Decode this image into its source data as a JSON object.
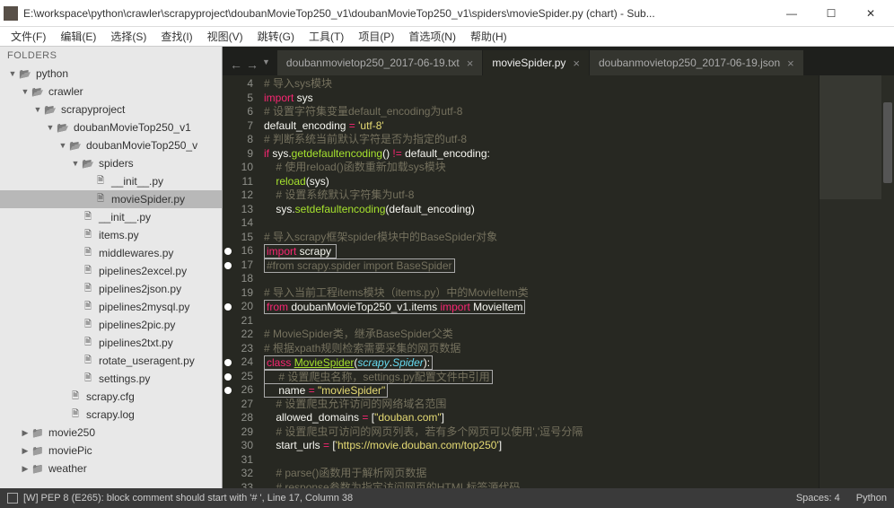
{
  "window": {
    "title": "E:\\workspace\\python\\crawler\\scrapyproject\\doubanMovieTop250_v1\\doubanMovieTop250_v1\\spiders\\movieSpider.py (chart) - Sub..."
  },
  "menu": [
    "文件(F)",
    "编辑(E)",
    "选择(S)",
    "查找(I)",
    "视图(V)",
    "跳转(G)",
    "工具(T)",
    "项目(P)",
    "首选项(N)",
    "帮助(H)"
  ],
  "sidebar": {
    "header": "FOLDERS",
    "tree": [
      {
        "depth": 0,
        "kind": "folder-open",
        "exp": "▼",
        "label": "python"
      },
      {
        "depth": 1,
        "kind": "folder-open",
        "exp": "▼",
        "label": "crawler"
      },
      {
        "depth": 2,
        "kind": "folder-open",
        "exp": "▼",
        "label": "scrapyproject"
      },
      {
        "depth": 3,
        "kind": "folder-open",
        "exp": "▼",
        "label": "doubanMovieTop250_v1"
      },
      {
        "depth": 4,
        "kind": "folder-open",
        "exp": "▼",
        "label": "doubanMovieTop250_v"
      },
      {
        "depth": 5,
        "kind": "folder-open",
        "exp": "▼",
        "label": "spiders"
      },
      {
        "depth": 6,
        "kind": "file",
        "exp": "",
        "label": "__init__.py"
      },
      {
        "depth": 6,
        "kind": "file",
        "exp": "",
        "label": "movieSpider.py",
        "active": true
      },
      {
        "depth": 5,
        "kind": "file",
        "exp": "",
        "label": "__init__.py"
      },
      {
        "depth": 5,
        "kind": "file",
        "exp": "",
        "label": "items.py"
      },
      {
        "depth": 5,
        "kind": "file",
        "exp": "",
        "label": "middlewares.py"
      },
      {
        "depth": 5,
        "kind": "file",
        "exp": "",
        "label": "pipelines2excel.py"
      },
      {
        "depth": 5,
        "kind": "file",
        "exp": "",
        "label": "pipelines2json.py"
      },
      {
        "depth": 5,
        "kind": "file",
        "exp": "",
        "label": "pipelines2mysql.py"
      },
      {
        "depth": 5,
        "kind": "file",
        "exp": "",
        "label": "pipelines2pic.py"
      },
      {
        "depth": 5,
        "kind": "file",
        "exp": "",
        "label": "pipelines2txt.py"
      },
      {
        "depth": 5,
        "kind": "file",
        "exp": "",
        "label": "rotate_useragent.py"
      },
      {
        "depth": 5,
        "kind": "file",
        "exp": "",
        "label": "settings.py"
      },
      {
        "depth": 4,
        "kind": "file",
        "exp": "",
        "label": "scrapy.cfg"
      },
      {
        "depth": 4,
        "kind": "file",
        "exp": "",
        "label": "scrapy.log"
      },
      {
        "depth": 1,
        "kind": "folder",
        "exp": "▶",
        "label": "movie250"
      },
      {
        "depth": 1,
        "kind": "folder",
        "exp": "▶",
        "label": "moviePic"
      },
      {
        "depth": 1,
        "kind": "folder",
        "exp": "▶",
        "label": "weather"
      }
    ]
  },
  "tabs": [
    {
      "label": "doubanmovietop250_2017-06-19.txt",
      "active": false
    },
    {
      "label": "movieSpider.py",
      "active": true
    },
    {
      "label": "doubanmovietop250_2017-06-19.json",
      "active": false
    }
  ],
  "gutter": {
    "start": 4,
    "end": 33,
    "marks": [
      16,
      17,
      20,
      24,
      25,
      26
    ]
  },
  "code": [
    {
      "t": "comment",
      "text": "# 导入sys模块"
    },
    {
      "html": "<span class='c-key'>import</span> sys"
    },
    {
      "t": "comment",
      "text": "# 设置字符集变量default_encoding为utf-8"
    },
    {
      "html": "default_encoding <span class='c-op'>=</span> <span class='c-str'>'utf-8'</span>"
    },
    {
      "t": "comment",
      "text": "# 判断系统当前默认字符是否为指定的utf-8"
    },
    {
      "html": "<span class='c-key'>if</span> sys.<span class='c-func'>getdefaultencoding</span>() <span class='c-op'>!=</span> default_encoding:"
    },
    {
      "t": "comment",
      "indent": 1,
      "text": "# 使用reload()函数重新加载sys模块"
    },
    {
      "indent": 1,
      "html": "<span class='c-func'>reload</span>(sys)"
    },
    {
      "t": "comment",
      "indent": 1,
      "text": "# 设置系统默认字符集为utf-8"
    },
    {
      "indent": 1,
      "html": "sys.<span class='c-func'>setdefaultencoding</span>(default_encoding)"
    },
    {
      "text": ""
    },
    {
      "t": "comment",
      "text": "# 导入scrapy框架spider模块中的BaseSpider对象"
    },
    {
      "box": true,
      "html": "<span class='c-key'>import</span> scrapy "
    },
    {
      "box": true,
      "html": "<span class='c-comment'>#from scrapy.spider import BaseSpider</span>"
    },
    {
      "text": ""
    },
    {
      "t": "comment",
      "text": "# 导入当前工程items模块（items.py）中的MovieItem类"
    },
    {
      "box": true,
      "html": "<span class='c-key'>from</span> doubanMovieTop250_v1.items <span class='c-key'>import</span> MovieItem"
    },
    {
      "text": ""
    },
    {
      "t": "comment",
      "text": "# MovieSpider类，继承BaseSpider父类"
    },
    {
      "t": "comment",
      "text": "# 根据xpath规则检索需要采集的网页数据"
    },
    {
      "box": true,
      "html": "<span class='c-key'>class</span> <span class='c-class'>MovieSpider</span>(<span class='c-type'>scrapy</span>.<span class='c-type'>Spider</span>):"
    },
    {
      "box": true,
      "indent": 1,
      "html": "<span class='c-comment'># 设置爬虫名称，settings.py配置文件中引用</span>"
    },
    {
      "box": true,
      "indent": 1,
      "html": "name <span class='c-op'>=</span> <span class='c-str'>\"movieSpider\"</span>"
    },
    {
      "t": "comment",
      "indent": 1,
      "text": "# 设置爬虫允许访问的网络域名范围"
    },
    {
      "indent": 1,
      "html": "allowed_domains <span class='c-op'>=</span> [<span class='c-str'>\"douban.com\"</span>]"
    },
    {
      "t": "comment",
      "indent": 1,
      "text": "# 设置爬虫可访问的网页列表，若有多个网页可以使用','逗号分隔"
    },
    {
      "indent": 1,
      "html": "start_urls <span class='c-op'>=</span> [<span class='c-str'>'https://movie.douban.com/top250'</span>]"
    },
    {
      "text": ""
    },
    {
      "t": "comment",
      "indent": 1,
      "text": "# parse()函数用于解析网页数据"
    },
    {
      "t": "comment",
      "indent": 1,
      "text": "# response参数为指定访问网页的HTML标签源代码"
    }
  ],
  "statusbar": {
    "left": "[W] PEP 8 (E265): block comment should start with '# ', Line 17, Column 38",
    "spaces": "Spaces: 4",
    "lang": "Python"
  }
}
